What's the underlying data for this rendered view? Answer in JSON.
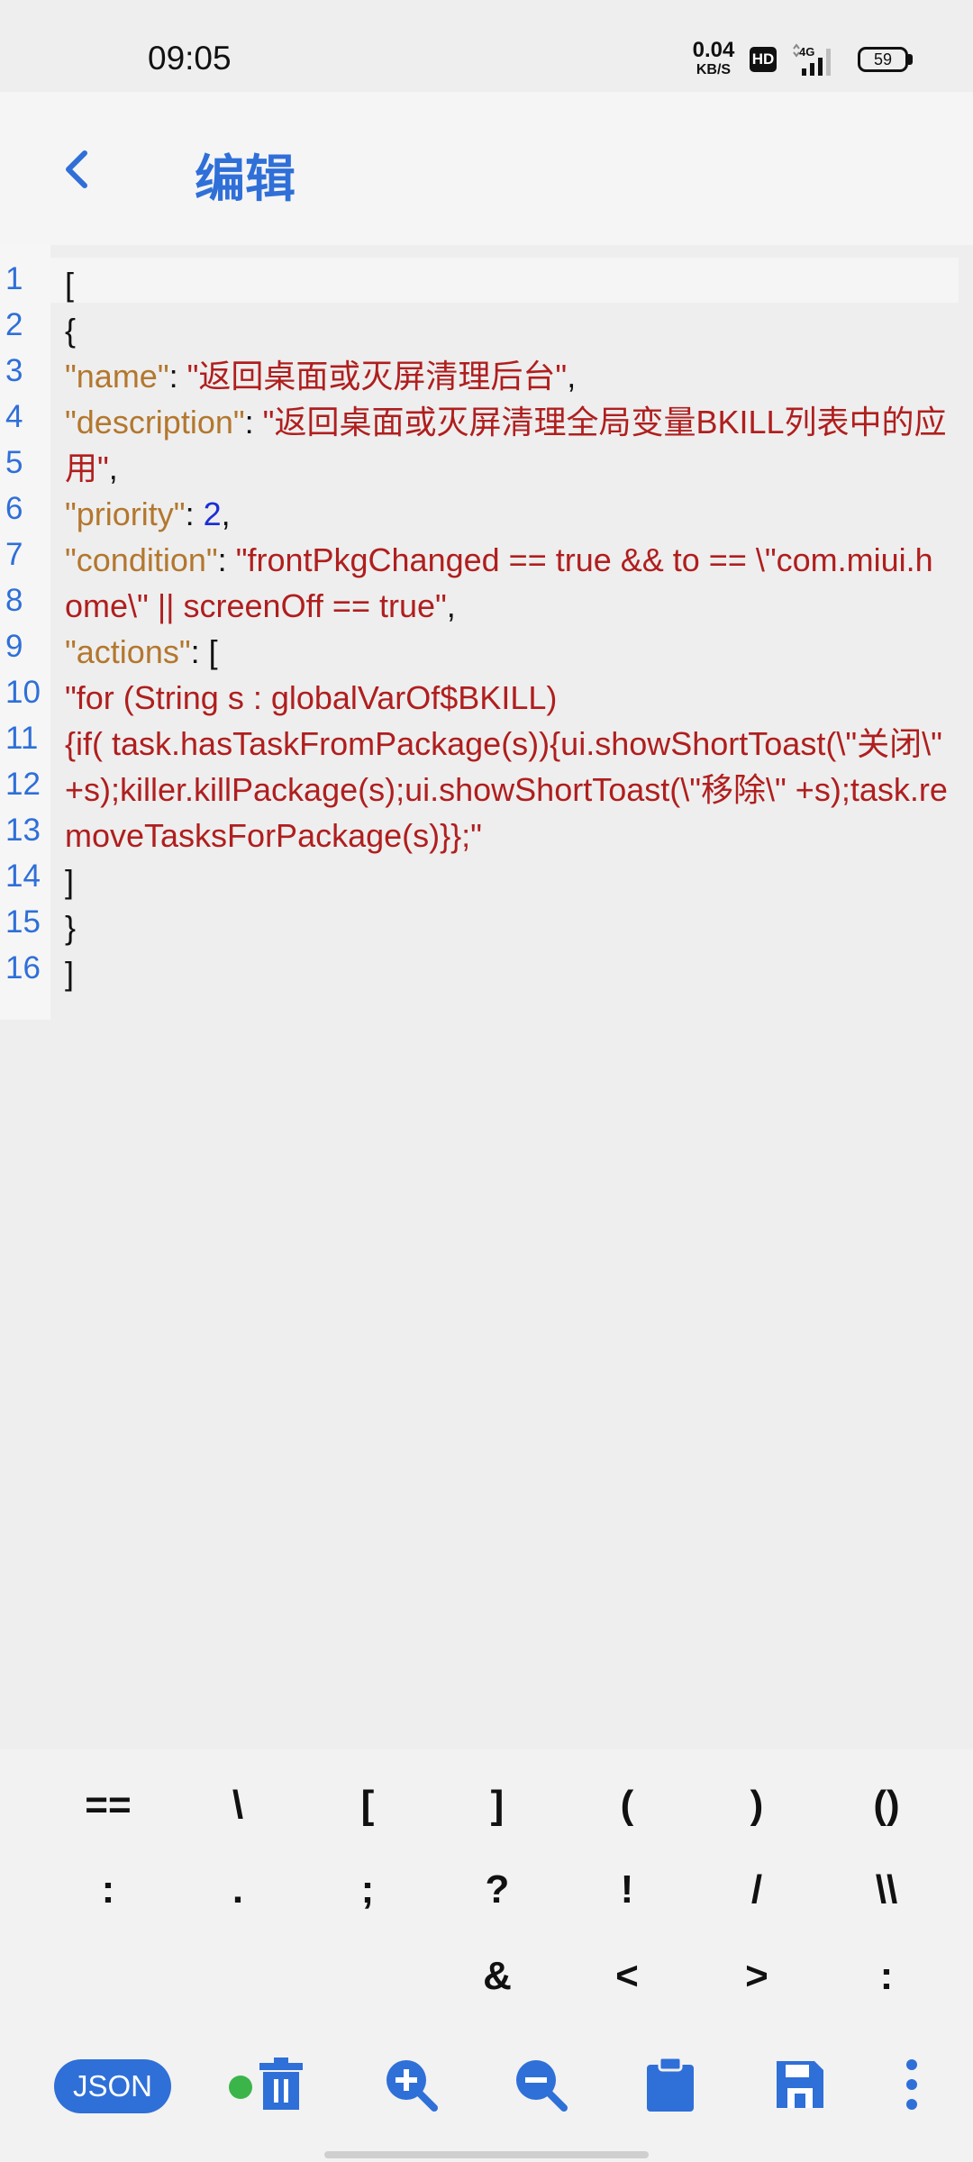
{
  "status": {
    "time": "09:05",
    "speed_value": "0.04",
    "speed_unit": "KB/S",
    "hd": "HD",
    "network": "4G",
    "battery": "59"
  },
  "appbar": {
    "title": "编辑",
    "back_icon": "back-arrow-icon"
  },
  "editor": {
    "line_numbers": [
      "1",
      "2",
      "3",
      "4",
      "5",
      "6",
      "7",
      "8",
      "9",
      "10",
      "11",
      "12",
      "13",
      "14",
      "15",
      "16"
    ],
    "lines": [
      {
        "parts": [
          {
            "t": "[",
            "c": "p"
          }
        ]
      },
      {
        "parts": [
          {
            "t": "{",
            "c": "p"
          }
        ]
      },
      {
        "parts": [
          {
            "t": "\"name\"",
            "c": "k"
          },
          {
            "t": ": ",
            "c": "p"
          },
          {
            "t": "\"返回桌面或灭屏清理后台\"",
            "c": "s"
          },
          {
            "t": ",",
            "c": "p"
          }
        ]
      },
      {
        "parts": [
          {
            "t": "\"description\"",
            "c": "k"
          },
          {
            "t": ": ",
            "c": "p"
          },
          {
            "t": "\"返回桌面或灭屏清理全局变量BKILL列表中的应用\"",
            "c": "s"
          },
          {
            "t": ",",
            "c": "p"
          }
        ]
      },
      {
        "parts": [
          {
            "t": "\"priority\"",
            "c": "k"
          },
          {
            "t": ": ",
            "c": "p"
          },
          {
            "t": "2",
            "c": "n"
          },
          {
            "t": ",",
            "c": "p"
          }
        ]
      },
      {
        "parts": [
          {
            "t": "\"condition\"",
            "c": "k"
          },
          {
            "t": ": ",
            "c": "p"
          },
          {
            "t": "\"frontPkgChanged == true && to == \\\"com.miui.home\\\" || screenOff == true\"",
            "c": "s"
          },
          {
            "t": ",",
            "c": "p"
          }
        ]
      },
      {
        "parts": [
          {
            "t": "\"actions\"",
            "c": "k"
          },
          {
            "t": ": [",
            "c": "p"
          }
        ]
      },
      {
        "parts": [
          {
            "t": "\"for (String s : globalVarOf$BKILL)",
            "c": "s"
          }
        ]
      },
      {
        "parts": [
          {
            "t": "{if( task.hasTaskFromPackage(s)){ui.showShortToast(\\\"关闭\\\" +s);killer.killPackage(s);ui.showShortToast(\\\"移除\\\" +s);task.removeTasksForPackage(s)}};\"",
            "c": "s"
          }
        ]
      },
      {
        "parts": [
          {
            "t": "]",
            "c": "p"
          }
        ]
      },
      {
        "parts": [
          {
            "t": "}",
            "c": "p"
          }
        ]
      },
      {
        "parts": [
          {
            "t": "]",
            "c": "p"
          }
        ]
      }
    ]
  },
  "symbols": [
    [
      "==",
      "\\",
      "[",
      "]",
      "(",
      ")",
      "()"
    ],
    [
      ":",
      ".",
      ";",
      "?",
      "!",
      "/",
      "\\\\"
    ],
    [
      "",
      "",
      "",
      "&",
      "<",
      ">",
      ":"
    ]
  ],
  "toolbar": {
    "json_label": "JSON",
    "icons": [
      "delete-icon",
      "zoom-in-icon",
      "zoom-out-icon",
      "clipboard-icon",
      "save-icon",
      "more-vert-icon"
    ],
    "accent": "#2f6fd8",
    "dot_color": "#3bb54a"
  }
}
